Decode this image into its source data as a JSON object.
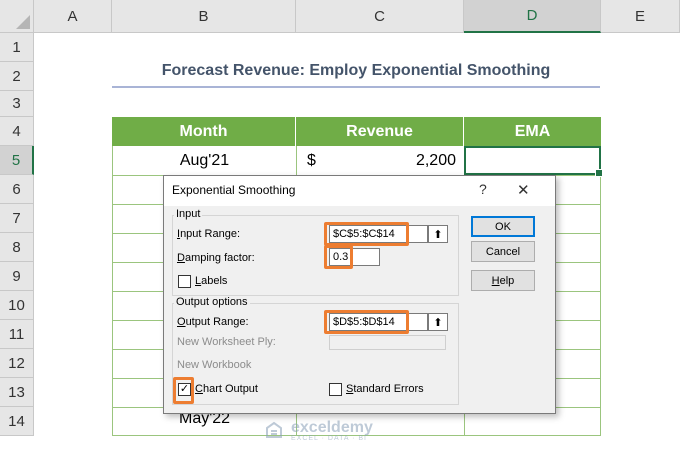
{
  "columns": [
    "A",
    "B",
    "C",
    "D",
    "E"
  ],
  "selected_column": "D",
  "rows": [
    "1",
    "2",
    "3",
    "4",
    "5",
    "6",
    "7",
    "8",
    "9",
    "10",
    "11",
    "12",
    "13",
    "14"
  ],
  "selected_row": "5",
  "title": "Forecast Revenue: Employ Exponential Smoothing",
  "table": {
    "headers": [
      "Month",
      "Revenue",
      "EMA"
    ],
    "first_row": {
      "month": "Aug'21",
      "currency": "$",
      "revenue": "2,200"
    },
    "last_month": "May'22"
  },
  "dialog": {
    "title": "Exponential Smoothing",
    "help_glyph": "?",
    "close_glyph": "✕",
    "input_group": "Input",
    "input_range_label_ul": "I",
    "input_range_label_rest": "nput Range:",
    "input_range_value": "$C$5:$C$14",
    "damping_label_ul": "D",
    "damping_label_rest": "amping factor:",
    "damping_value": "0.3",
    "labels_label_ul": "L",
    "labels_label_rest": "abels",
    "output_group": "Output options",
    "output_range_label_ul": "O",
    "output_range_label_rest": "utput Range:",
    "output_range_value": "$D$5:$D$14",
    "new_ply_label": "New Worksheet Ply:",
    "new_workbook_label": "New Workbook",
    "chart_output_label_ul": "C",
    "chart_output_label_rest": "hart Output",
    "chart_output_checked": true,
    "std_errors_label_ul": "S",
    "std_errors_label_rest": "tandard Errors",
    "ok_label": "OK",
    "cancel_label": "Cancel",
    "help_ul": "H",
    "help_rest": "elp",
    "collapse_glyph": "⬆"
  },
  "watermark": {
    "name": "exceldemy",
    "tagline": "EXCEL · DATA · BI"
  },
  "colors": {
    "header_green": "#70ad47",
    "highlight_orange": "#ed7d31",
    "excel_green": "#217346",
    "title_color": "#44546a"
  }
}
